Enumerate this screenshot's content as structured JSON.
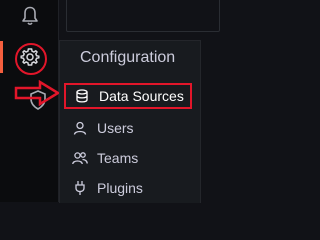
{
  "sidebar": {
    "icons": [
      {
        "name": "bell-icon"
      },
      {
        "name": "gear-icon"
      },
      {
        "name": "shield-icon"
      }
    ],
    "accent": "#f55f3e",
    "highlight": "#e2162a"
  },
  "menu": {
    "header": "Configuration",
    "items": [
      {
        "label": "Data Sources",
        "icon": "database-icon"
      },
      {
        "label": "Users",
        "icon": "user-icon"
      },
      {
        "label": "Teams",
        "icon": "users-icon"
      },
      {
        "label": "Plugins",
        "icon": "plug-icon"
      }
    ]
  }
}
